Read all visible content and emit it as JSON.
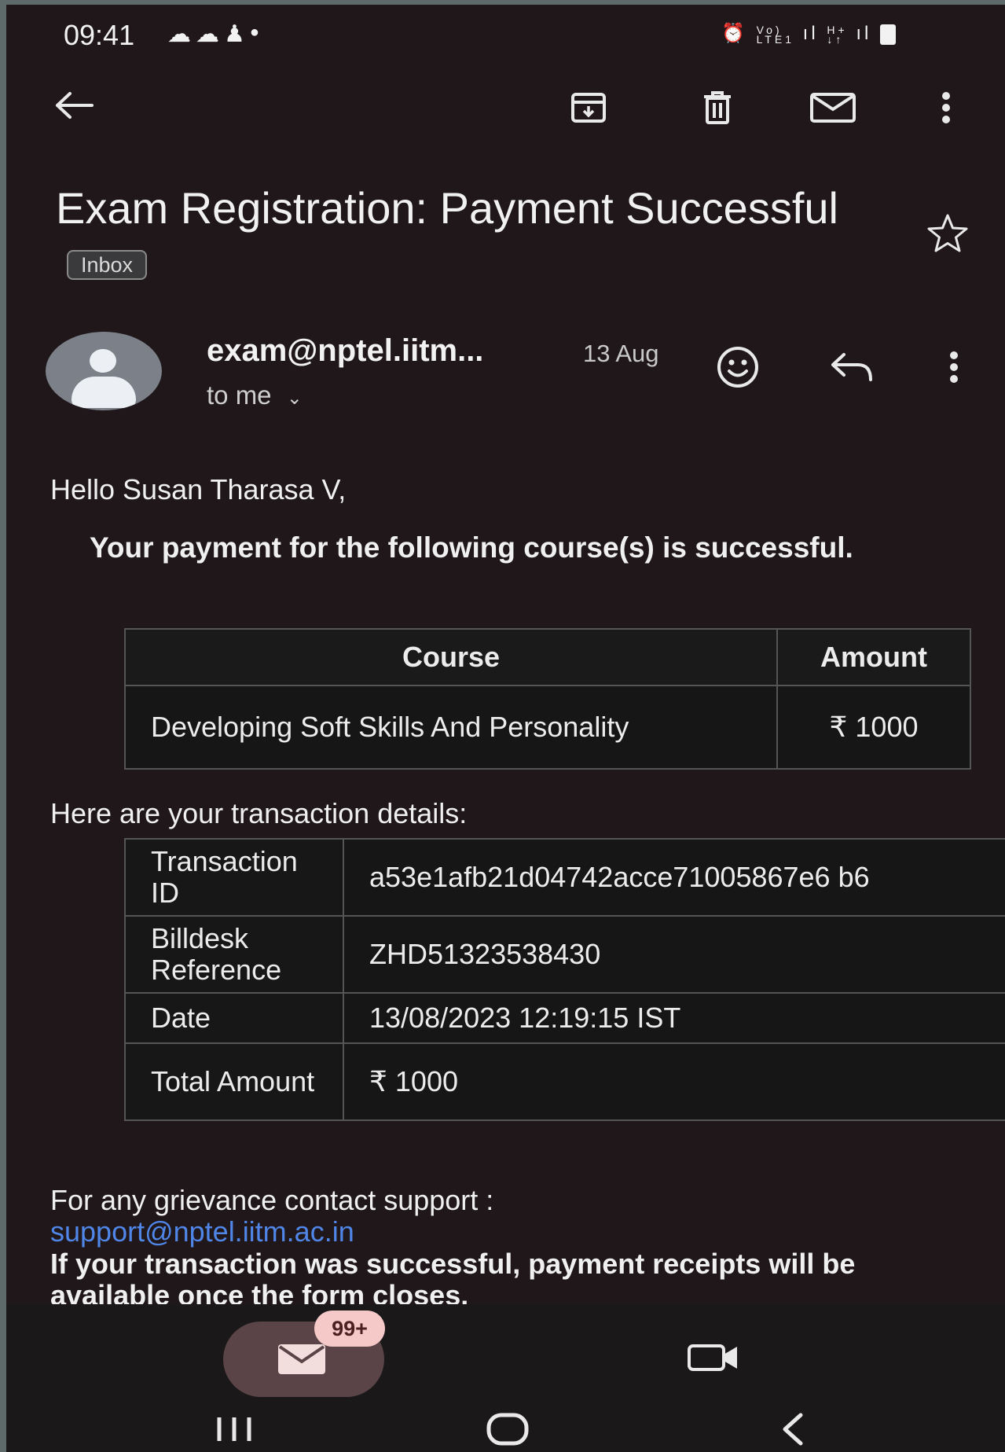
{
  "status_bar": {
    "time": "09:41",
    "left_icons": [
      "cloud-icon",
      "cloud-icon",
      "snapchat-icon",
      "dot-icon"
    ],
    "right_icons": [
      "alarm-icon",
      "volte-icon",
      "signal-icon",
      "h-plus-icon",
      "signal-icon",
      "battery-icon"
    ]
  },
  "toolbar": {
    "icons": [
      "back-arrow-icon",
      "archive-icon",
      "delete-icon",
      "mark-unread-icon",
      "more-vert-icon"
    ]
  },
  "email": {
    "subject": "Exam Registration: Payment Successful",
    "label": "Inbox",
    "sender": "exam@nptel.iitm...",
    "date": "13 Aug",
    "recipient": "to me",
    "greeting": "Hello Susan Tharasa V,",
    "payment_message": "Your payment for the following course(s) is successful.",
    "course_table": {
      "headers": [
        "Course",
        "Amount"
      ],
      "rows": [
        {
          "course": "Developing Soft Skills And Personality",
          "amount": "₹ 1000"
        }
      ]
    },
    "transaction_title": "Here are your transaction details:",
    "transaction": {
      "rows": [
        {
          "label": "Transaction ID",
          "value": "a53e1afb21d04742acce71005867e6 b6"
        },
        {
          "label": "Billdesk Reference",
          "value": "ZHD51323538430"
        },
        {
          "label": "Date",
          "value": "13/08/2023 12:19:15 IST"
        },
        {
          "label": "Total Amount",
          "value": "₹ 1000"
        }
      ]
    },
    "grievance_text": "For any grievance contact support :",
    "support_email": "support@nptel.iitm.ac.in",
    "receipt_note": "If your transaction was successful, payment receipts will be available once the form closes."
  },
  "bottom_nav": {
    "mail_badge": "99+",
    "icons": [
      "mail-icon",
      "video-icon"
    ]
  },
  "system_nav": {
    "icons": [
      "recents-icon",
      "home-icon",
      "back-icon"
    ]
  },
  "colors": {
    "background": "#1f1719",
    "link": "#4f86e8",
    "badge": "#f6c9c9",
    "pill": "#5b4447"
  }
}
